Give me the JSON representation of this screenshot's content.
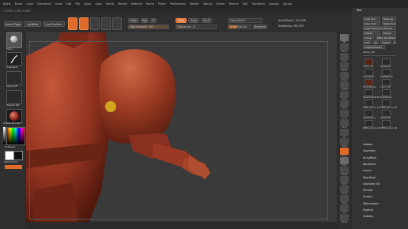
{
  "menubar": {
    "items": [
      "Alpha",
      "Brush",
      "Color",
      "Document",
      "Draw",
      "Edit",
      "File",
      "Layer",
      "Light",
      "Macro",
      "Marker",
      "Material",
      "Movie",
      "Picker",
      "Preferences",
      "Render",
      "Stencil",
      "Stroke",
      "Texture",
      "Tool",
      "Transform",
      "Zplugin",
      "Zscript"
    ]
  },
  "coords": "-0.076,-0.295,-0.853",
  "topshelf": {
    "home_page": "Home Page",
    "lightbox": "LightBox",
    "live_boolean": "Live Boolean",
    "mrgb": "Mrgb",
    "rgb": "Rgb",
    "m": "M",
    "zadd": "Zadd",
    "zsub": "Zsub",
    "zcut": "Zcut",
    "rgb_intensity": "Rgb Intensity 100",
    "z_intensity": "Z Intensity 13",
    "focal_shift": "Focal Shift 0",
    "draw_size": "Draw Size 64",
    "dynamic": "Dynamic",
    "active_points": "ActivePoints: 794,436",
    "total_points": "TotalPoints: 382,963"
  },
  "leftshelf": {
    "brush_label": "Move",
    "stroke_label": "FreeHand",
    "alpha_label": "Alpha Off",
    "texture_label": "Texture Off",
    "material_label": "MatCap Red Wax",
    "gradient_label": "Gradient",
    "switch_color": "SwitchColor",
    "alternate": "Alternate"
  },
  "rightshelf": {
    "labels": [
      "BPR",
      "SPix 3",
      "Scroll",
      "Zoom",
      "Actual",
      "AAHalf",
      "Persp",
      "Floor",
      "Local",
      "LSym",
      "Xyz",
      "Frame",
      "Move",
      "Scale",
      "Rotate",
      "PolyF",
      "Transp",
      "Ghost",
      "Solo",
      "Xpose"
    ]
  },
  "toolpanel": {
    "title": "Tool",
    "load_tool": "Load Tool",
    "save_as": "Save As",
    "copy_tool": "Copy Tool",
    "paste_tool": "Paste Tool",
    "load_from_project": "Load Tools From Project",
    "import": "Import",
    "export": "Export",
    "clone": "Clone",
    "make_polymesh": "Make PolyMesh3D",
    "goz": "GoZ",
    "all": "All",
    "visible": "Visible",
    "r": "R",
    "lightbox_tools": "Lightbox▸Tools",
    "current_tool": "Armor_18",
    "count": "R",
    "thumbs": [
      "Armor_18",
      "Sphere3D",
      "Cylinder3D",
      "PolyMesh3D",
      "SimpleBrush",
      "Armor_18",
      "SphereInflate3D",
      "PolySphere",
      "PM3D_Armor_18",
      "PM3D_Armor_18",
      "Sphere3D_1",
      "Sphere3D",
      "PM3D_Armor_18",
      "PM3D_Armor_18"
    ],
    "subpalettes": [
      "Subtool",
      "Geometry",
      "ArrayMesh",
      "NanoMesh",
      "Layers",
      "FiberMesh",
      "Geometry HD",
      "Preview",
      "Surface",
      "Deformation",
      "Masking",
      "Visibility"
    ]
  },
  "colors": {
    "accent": "#e06a2a",
    "model": "#9a3a22",
    "cursor": "#d9b21f"
  }
}
